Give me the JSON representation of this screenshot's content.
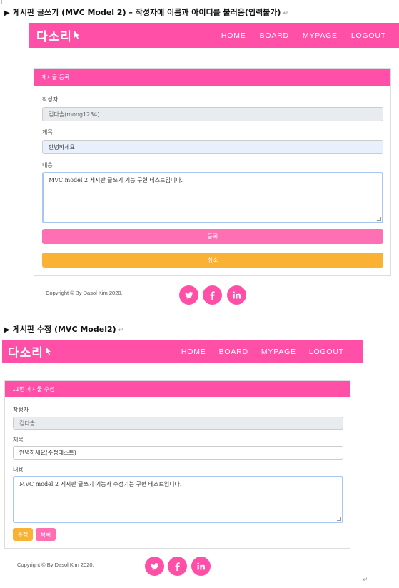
{
  "doc": {
    "heading1": "게시판 글쓰기 (MVC Model 2) – 작성자에 이름과 아이디를 불러옴(입력불가)",
    "heading2": "게시판 수정 (MVC Model2)",
    "bullet": "▶",
    "para_mark": "↵"
  },
  "nav": {
    "logo": "다소리",
    "links": [
      "HOME",
      "BOARD",
      "MYPAGE",
      "LOGOUT"
    ]
  },
  "write_form": {
    "header": "게시글 등록",
    "author_label": "작성자",
    "author_value": "김다솔(mong1234)",
    "title_label": "제목",
    "title_value": "안녕하세요",
    "content_label": "내용",
    "content_mvc": "MVC",
    "content_rest": " model 2 게시판 글쓰기 기능 구현 테스트입니다.",
    "submit_label": "등록",
    "cancel_label": "취소"
  },
  "edit_form": {
    "header": "11번 게시물 수정",
    "author_label": "작성자",
    "author_value": "김다솔",
    "title_label": "제목",
    "title_value": "안녕하세요(수정테스트)",
    "content_label": "내용",
    "content_mvc": "MVC",
    "content_rest": " model 2 게시판 글쓰기 기능과 수정기능 구현 테스트입니다.",
    "edit_label": "수정",
    "list_label": "목록"
  },
  "footer": {
    "copyright": "Copyright © By Dasol Kim 2020.",
    "social": [
      "twitter-icon",
      "facebook-icon",
      "linkedin-icon"
    ]
  },
  "colors": {
    "brand_pink": "#ff4fa7",
    "button_pink": "#ff6fb3",
    "button_orange": "#f9b233"
  }
}
